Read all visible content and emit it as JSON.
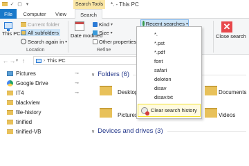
{
  "window": {
    "context_title": "Search Tools",
    "title": "*. - This PC"
  },
  "tabs": {
    "file": "File",
    "computer": "Computer",
    "view": "View",
    "search": "Search"
  },
  "ribbon": {
    "this_pc": "This PC",
    "current_folder": "Current folder",
    "all_subfolders": "All subfolders",
    "search_again_in": "Search again in",
    "location_group": "Location",
    "date_modified": "Date modified",
    "kind": "Kind",
    "size": "Size",
    "other_properties": "Other properties",
    "refine_group": "Refine",
    "recent_searches": "Recent searches",
    "close_search": "Close search"
  },
  "nav": {
    "address": "This PC"
  },
  "sidebar": {
    "items": [
      {
        "label": "Pictures",
        "icon": "pictures-icon",
        "pinned": true
      },
      {
        "label": "Google Drive",
        "icon": "google-drive-icon",
        "pinned": true
      },
      {
        "label": "IT4",
        "icon": "folder-icon",
        "pinned": true
      },
      {
        "label": "blackview",
        "icon": "folder-icon",
        "pinned": false
      },
      {
        "label": "file-history",
        "icon": "folder-icon",
        "pinned": false
      },
      {
        "label": "tinified",
        "icon": "folder-icon",
        "pinned": false
      },
      {
        "label": "tinified-VB",
        "icon": "folder-icon",
        "pinned": false
      }
    ]
  },
  "content": {
    "folders_header": "Folders (6)",
    "folders": [
      "Desktop",
      "Documents",
      "Pictures",
      "Videos"
    ],
    "devices_header": "Devices and drives (3)"
  },
  "recent_menu": {
    "items": [
      "*.",
      "*.pst",
      "*.pdf",
      "font",
      "safari",
      "deloton",
      "disav",
      "disav.txt"
    ],
    "clear": "Clear search history"
  },
  "colors": {
    "file_tab": "#1979ca",
    "highlight": "#f2e02b",
    "context_tab": "#fbe7a6"
  }
}
